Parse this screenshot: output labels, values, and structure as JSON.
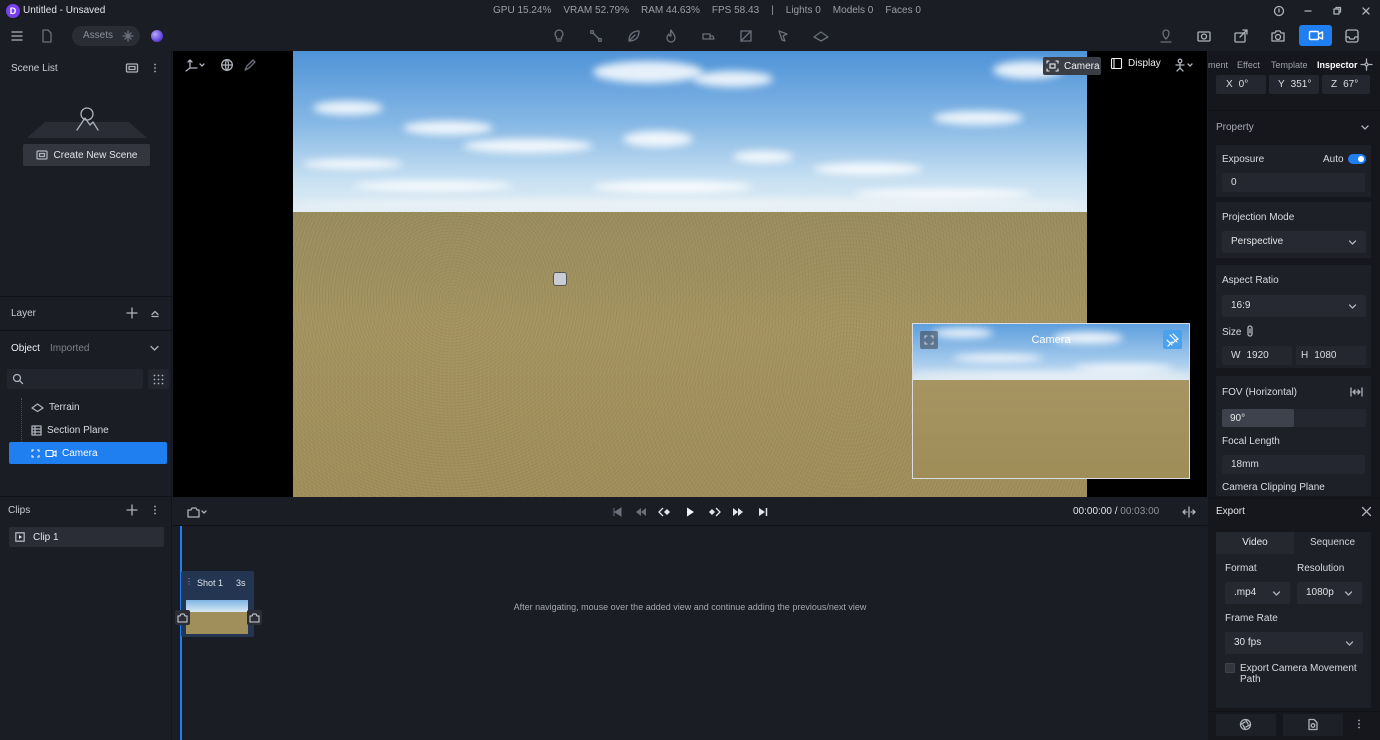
{
  "window": {
    "title": "Untitled - Unsaved",
    "logo_letter": "D",
    "stats": [
      "GPU 15.24%",
      "VRAM 52.79%",
      "RAM 44.63%",
      "FPS 58.43",
      "|",
      "Lights 0",
      "Models 0",
      "Faces 0"
    ]
  },
  "toolbar": {
    "assets_label": "Assets"
  },
  "scene_list": {
    "title": "Scene List",
    "create_button": "Create New Scene"
  },
  "layer": {
    "title": "Layer",
    "tabs": [
      "Object",
      "Imported"
    ],
    "items": [
      {
        "label": "Terrain",
        "icon": "terrain-icon"
      },
      {
        "label": "Section Plane",
        "icon": "section-plane-icon"
      },
      {
        "label": "Camera",
        "icon": "camera-icon",
        "selected": true
      }
    ]
  },
  "clips": {
    "title": "Clips",
    "items": [
      "Clip 1"
    ]
  },
  "viewport": {
    "camera_button": "Camera",
    "display_button": "Display",
    "preview_title": "Camera"
  },
  "timeline": {
    "current_time": "00:00:00",
    "separator": " / ",
    "total_time": "00:03:00",
    "shot_name": "Shot 1",
    "shot_duration": "3s",
    "hint": "After navigating, mouse over the added view and continue adding the previous/next view"
  },
  "inspector": {
    "tabs": [
      "ment",
      "Effect",
      "Template",
      "Inspector"
    ],
    "rotation": {
      "x_label": "X",
      "x": "0°",
      "y_label": "Y",
      "y": "351°",
      "z_label": "Z",
      "z": "67°"
    },
    "property_title": "Property",
    "exposure_label": "Exposure",
    "exposure_auto_label": "Auto",
    "exposure_auto": true,
    "exposure_value": "0",
    "projection_label": "Projection Mode",
    "projection_value": "Perspective",
    "aspect_label": "Aspect Ratio",
    "aspect_value": "16:9",
    "size_label": "Size",
    "width_label": "W",
    "width": "1920",
    "height_label": "H",
    "height": "1080",
    "fov_label": "FOV (Horizontal)",
    "fov_value": "90°",
    "fov_fill": 0.5,
    "focal_label": "Focal Length",
    "focal_value": "18mm",
    "clipping_label": "Camera Clipping Plane"
  },
  "export": {
    "title": "Export",
    "tabs": [
      "Video",
      "Sequence"
    ],
    "format_label": "Format",
    "format_value": ".mp4",
    "resolution_label": "Resolution",
    "resolution_value": "1080p",
    "framerate_label": "Frame Rate",
    "framerate_value": "30 fps",
    "export_path_label": "Export Camera Movement Path",
    "export_path_checked": false
  },
  "colors": {
    "accent": "#1f7ff0",
    "background": "#1b1d24",
    "panel": "#16171d"
  }
}
